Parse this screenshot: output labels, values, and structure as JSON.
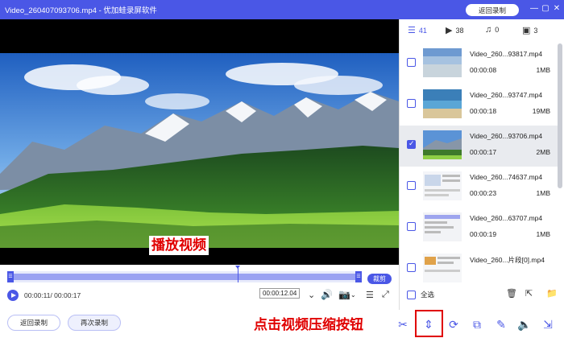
{
  "window": {
    "title": "Video_260407093706.mp4 - 优加蛙录屏软件",
    "back_record_label": "返回录制",
    "minimize": "—",
    "restore": "▢",
    "close": "✕"
  },
  "player": {
    "caption": "播放视频",
    "timeline": {
      "handle_left": "☰",
      "handle_right": "☰",
      "trim_label": "裁剪",
      "playhead_fraction": 0.65
    },
    "time_display": "00:00:11/ 00:00:17",
    "tooltip": "00:00:12.04"
  },
  "bottom": {
    "back_label": "返回录制",
    "record_again_label": "再次录制",
    "annotation": "点击视频压缩按钮",
    "tools": [
      "cut-icon",
      "compress-icon",
      "convert-icon",
      "merge-icon",
      "edit-icon",
      "volume-icon",
      "audio-extract-icon"
    ]
  },
  "sidebar": {
    "tabs": [
      {
        "icon": "list-icon",
        "count": "41"
      },
      {
        "icon": "video-icon",
        "count": "38"
      },
      {
        "icon": "music-icon",
        "count": "0"
      },
      {
        "icon": "image-icon",
        "count": "3"
      }
    ],
    "items": [
      {
        "name": "Video_260...93817.mp4",
        "duration": "00:00:08",
        "size": "1MB",
        "checked": false
      },
      {
        "name": "Video_260...93747.mp4",
        "duration": "00:00:18",
        "size": "19MB",
        "checked": false
      },
      {
        "name": "Video_260...93706.mp4",
        "duration": "00:00:17",
        "size": "2MB",
        "checked": true
      },
      {
        "name": "Video_260...74637.mp4",
        "duration": "00:00:23",
        "size": "1MB",
        "checked": false
      },
      {
        "name": "Video_260...63707.mp4",
        "duration": "00:00:19",
        "size": "1MB",
        "checked": false
      },
      {
        "name": "Video_260...片段[0].mp4",
        "duration": "",
        "size": "",
        "checked": false
      }
    ],
    "select_all_label": "全选"
  },
  "colors": {
    "accent": "#4a57e6",
    "highlight_red": "#e00000"
  }
}
